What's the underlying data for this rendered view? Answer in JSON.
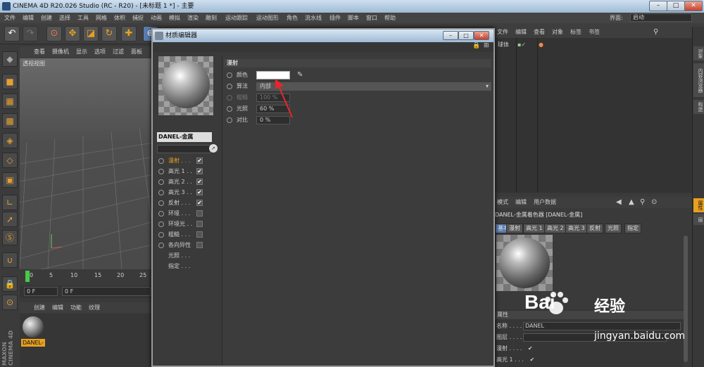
{
  "app": {
    "title": "CINEMA 4D R20.026 Studio (RC - R20) - [未标题 1 *] - 主要"
  },
  "menubar": {
    "items": [
      "文件",
      "编辑",
      "创建",
      "选择",
      "工具",
      "网格",
      "体积",
      "捕捉",
      "动画",
      "模拟",
      "渲染",
      "雕刻",
      "运动跟踪",
      "运动图形",
      "角色",
      "流水线",
      "插件",
      "脚本",
      "窗口",
      "帮助"
    ],
    "layout_label": "界面:",
    "layout_value": "启动"
  },
  "viewport": {
    "menu": [
      "查看",
      "摄像机",
      "显示",
      "选项",
      "过滤",
      "面板"
    ],
    "label": "透视视图"
  },
  "timeline": {
    "ticks": [
      "0",
      "5",
      "10",
      "15",
      "20",
      "25"
    ],
    "current_frame": "0 F",
    "start_frame": "0 F"
  },
  "material_manager": {
    "menu": [
      "创建",
      "编辑",
      "功能",
      "纹理"
    ],
    "material_label": "DANEL-"
  },
  "object_manager": {
    "menu": [
      "文件",
      "编辑",
      "查看",
      "对象",
      "标签",
      "书签"
    ],
    "object_name": "球体"
  },
  "right_tabs": [
    "对象",
    "内容浏览器",
    "构造",
    "属性",
    "层"
  ],
  "attribute_manager": {
    "menu": [
      "模式",
      "编辑",
      "用户数据"
    ],
    "title": "DANEL-金属着色器 [DANEL-金属]",
    "tabs": [
      "基本",
      "漫射",
      "高光 1",
      "高光 2",
      "高光 3",
      "反射",
      "光照",
      "指定"
    ],
    "section": "属性",
    "name_label": "名称 . . . .",
    "name_value": "DANEL",
    "layer_label": "图层 . . . .",
    "rows": [
      {
        "label": "漫射 . . . .",
        "checked": true
      },
      {
        "label": "高光 1 . . .",
        "checked": true
      }
    ]
  },
  "material_editor": {
    "title": "材质编辑器",
    "material_name": "DANEL-金属",
    "channels": [
      {
        "label": "漫射 . . .",
        "checked": true,
        "active": true
      },
      {
        "label": "高光 1 . .",
        "checked": true
      },
      {
        "label": "高光 2 . .",
        "checked": true
      },
      {
        "label": "高光 3 . .",
        "checked": true
      },
      {
        "label": "反射 . . .",
        "checked": true
      },
      {
        "label": "环境 . . .",
        "checked": false
      },
      {
        "label": "环境光 . .",
        "checked": false
      },
      {
        "label": "粗糙 . . .",
        "checked": false
      },
      {
        "label": "各向异性",
        "checked": false
      },
      {
        "label": "光照 . . .",
        "checked": null
      },
      {
        "label": "指定 . . .",
        "checked": null
      }
    ],
    "section": "漫射",
    "properties": [
      {
        "label": "颜色",
        "value": ""
      },
      {
        "label": "算法",
        "value": "内部"
      },
      {
        "label": "粗糙",
        "value": "100 %"
      },
      {
        "label": "光照",
        "value": "60 %"
      },
      {
        "label": "对比",
        "value": "0 %"
      }
    ]
  },
  "watermark": {
    "brand": "Bai",
    "brand2": "经验",
    "url": "jingyan.baidu.com"
  },
  "colors": {
    "accent": "#e8a020",
    "arrow": "#e8262a"
  }
}
